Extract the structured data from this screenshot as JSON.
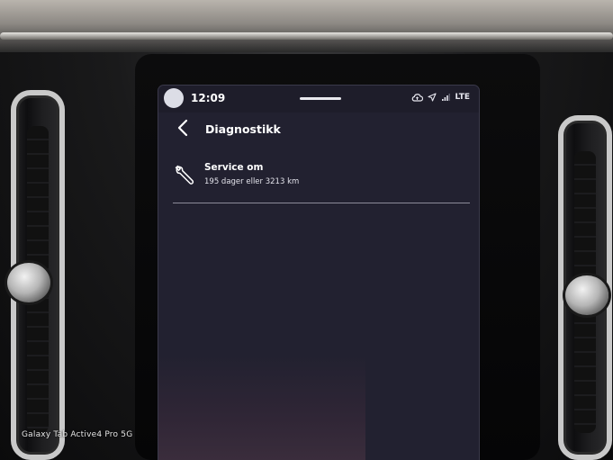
{
  "photo": {
    "caption": "Galaxy Tab Active4 Pro 5G"
  },
  "status_bar": {
    "time": "12:09",
    "network_label": "LTE",
    "icons": [
      "profile-avatar",
      "cloud-sync-icon",
      "location-arrow-icon",
      "signal-bars-icon"
    ]
  },
  "header": {
    "back_icon": "chevron-left-icon",
    "title": "Diagnostikk"
  },
  "items": [
    {
      "icon": "wrench-icon",
      "title": "Service om",
      "subtitle": "195 dager eller 3213 km"
    }
  ],
  "colors": {
    "screen_bg": "#222130",
    "statusbar_bg": "#1e1d2a",
    "text_primary": "#ffffff",
    "divider": "#8c8b99"
  }
}
